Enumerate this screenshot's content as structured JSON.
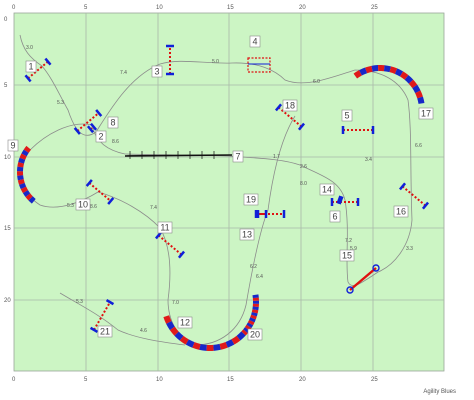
{
  "axes": {
    "x_ticks": [
      "0",
      "5",
      "10",
      "15",
      "20",
      "25"
    ],
    "y_ticks": [
      "0",
      "5",
      "10",
      "15",
      "20"
    ]
  },
  "colors": {
    "field": "#ccf5c4",
    "grid": "#a9b8a9",
    "path": "#8c8c8c",
    "bar_blue": "#1020d8",
    "bar_red": "#e01010",
    "tunnel_red": "#e01a1a",
    "tunnel_blue": "#1828c8"
  },
  "obstacles": [
    {
      "number": "1",
      "type": "jump"
    },
    {
      "number": "2",
      "type": "jump"
    },
    {
      "number": "3",
      "type": "jump"
    },
    {
      "number": "4",
      "type": "tire"
    },
    {
      "number": "5",
      "type": "jump"
    },
    {
      "number": "6",
      "type": "jump"
    },
    {
      "number": "7",
      "type": "dogwalk"
    },
    {
      "number": "8",
      "type": "jump"
    },
    {
      "number": "9",
      "type": "tunnel"
    },
    {
      "number": "10",
      "type": "jump"
    },
    {
      "number": "11",
      "type": "jump"
    },
    {
      "number": "12",
      "type": "tunnel"
    },
    {
      "number": "13",
      "type": "jump"
    },
    {
      "number": "14",
      "type": "jump"
    },
    {
      "number": "15",
      "type": "jump"
    },
    {
      "number": "16",
      "type": "jump"
    },
    {
      "number": "17",
      "type": "tunnel"
    },
    {
      "number": "18",
      "type": "jump"
    },
    {
      "number": "19",
      "type": "jump"
    },
    {
      "number": "20",
      "type": "tunnel"
    },
    {
      "number": "21",
      "type": "jump"
    }
  ],
  "distances": [
    "3.0",
    "5.3",
    "7.4",
    "5.0",
    "6.0",
    "8.6",
    "1.7",
    "2.6",
    "3.4",
    "5.3",
    "8.6",
    "7.4",
    "7.0",
    "5.3",
    "4.6",
    "6.2",
    "7.2",
    "8.0",
    "6.6",
    "5.9",
    "3.3",
    "6.4"
  ],
  "footer": {
    "credit": "Agility Blues"
  }
}
